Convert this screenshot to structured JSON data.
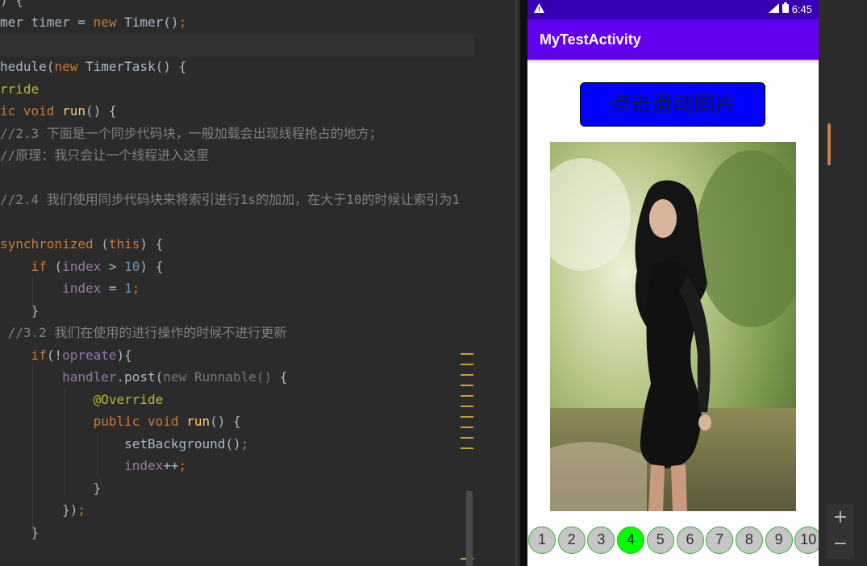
{
  "editor": {
    "lines": [
      [
        [
          "tok-plain",
          ") {"
        ]
      ],
      [
        [
          "tok-plain",
          "mer timer = "
        ],
        [
          "tok-kw",
          "new "
        ],
        [
          "tok-plain",
          "Timer()"
        ],
        [
          "tok-kw",
          ";"
        ]
      ],
      [
        [
          "tok-plain",
          ""
        ]
      ],
      [
        [
          "tok-plain",
          "hedule("
        ],
        [
          "tok-kw",
          "new "
        ],
        [
          "tok-plain",
          "TimerTask() {"
        ]
      ],
      [
        [
          "tok-ann",
          "rride"
        ]
      ],
      [
        [
          "tok-kw",
          "ic void "
        ],
        [
          "tok-fn",
          "run"
        ],
        [
          "tok-plain",
          "() {"
        ]
      ],
      [
        [
          "tok-cm",
          "//2.3 下面是一个同步代码块，一般加载会出现线程抢占的地方；"
        ]
      ],
      [
        [
          "tok-cm",
          "//原理：我只会让一个线程进入这里"
        ]
      ],
      [
        [
          "tok-plain",
          ""
        ]
      ],
      [
        [
          "tok-cm",
          "//2.4 我们使用同步代码块来将索引进行1s的加加，在大于10的时候让索引为1"
        ]
      ],
      [
        [
          "tok-plain",
          ""
        ]
      ],
      [
        [
          "tok-kw",
          "synchronized "
        ],
        [
          "tok-plain",
          "("
        ],
        [
          "tok-kw",
          "this"
        ],
        [
          "tok-plain",
          ") {"
        ]
      ],
      [
        [
          "tok-plain",
          "    "
        ],
        [
          "tok-kw",
          "if "
        ],
        [
          "tok-plain",
          "("
        ],
        [
          "tok-var",
          "index"
        ],
        [
          "tok-plain",
          " > "
        ],
        [
          "tok-num",
          "10"
        ],
        [
          "tok-plain",
          ") {"
        ]
      ],
      [
        [
          "tok-plain",
          "        "
        ],
        [
          "tok-var",
          "index"
        ],
        [
          "tok-plain",
          " = "
        ],
        [
          "tok-num",
          "1"
        ],
        [
          "tok-kw",
          ";"
        ]
      ],
      [
        [
          "tok-plain",
          "    }"
        ]
      ],
      [
        [
          "tok-cm",
          " //3.2 我们在使用的进行操作的时候不进行更新"
        ]
      ],
      [
        [
          "tok-plain",
          "    "
        ],
        [
          "tok-kw",
          "if"
        ],
        [
          "tok-plain",
          "(!"
        ],
        [
          "tok-var",
          "opreate"
        ],
        [
          "tok-plain",
          "){"
        ]
      ],
      [
        [
          "tok-plain",
          "        "
        ],
        [
          "tok-var",
          "handler"
        ],
        [
          "tok-plain",
          ".post("
        ],
        [
          "tok-dim",
          "new Runnable() "
        ],
        [
          "tok-plain",
          "{"
        ]
      ],
      [
        [
          "tok-plain",
          "            "
        ],
        [
          "tok-ann",
          "@Override"
        ]
      ],
      [
        [
          "tok-plain",
          "            "
        ],
        [
          "tok-kw",
          "public void "
        ],
        [
          "tok-fn",
          "run"
        ],
        [
          "tok-plain",
          "() {"
        ]
      ],
      [
        [
          "tok-plain",
          "                setBackground()"
        ],
        [
          "tok-kw",
          ";"
        ]
      ],
      [
        [
          "tok-plain",
          "                "
        ],
        [
          "tok-var",
          "index"
        ],
        [
          "tok-plain",
          "++"
        ],
        [
          "tok-kw",
          ";"
        ]
      ],
      [
        [
          "tok-plain",
          "            }"
        ]
      ],
      [
        [
          "tok-plain",
          "        })"
        ],
        [
          "tok-kw",
          ";"
        ]
      ],
      [
        [
          "tok-plain",
          "    }"
        ]
      ]
    ]
  },
  "phone": {
    "status_time": "6:45",
    "app_title": "MyTestActivity",
    "button_label": "点击滑动图片",
    "selected_index": 4,
    "dots": [
      "1",
      "2",
      "3",
      "4",
      "5",
      "6",
      "7",
      "8",
      "9",
      "10"
    ]
  },
  "zoom": {
    "plus": "+",
    "minus": "−"
  },
  "colors": {
    "status_bar": "#3700b3",
    "app_bar": "#6200ee",
    "button": "#0000ff",
    "active_dot": "#00ff00",
    "inactive_dot": "#c6c6c6"
  }
}
